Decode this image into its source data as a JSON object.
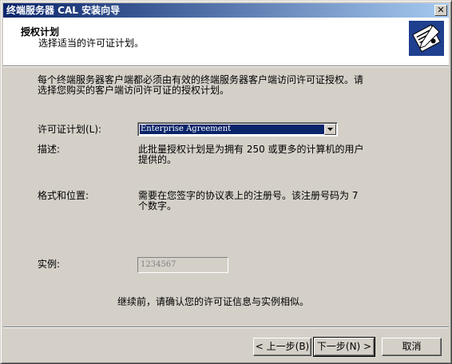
{
  "window": {
    "title": "终端服务器 CAL 安装向导",
    "close_symbol": "✕"
  },
  "header": {
    "title": "授权计划",
    "subtitle": "选择适当的许可证计划。",
    "icon": "license-document-icon"
  },
  "content": {
    "intro_line1": "每个终端服务器客户端都必须由有效的终端服务器客户端访问许可证授权。请",
    "intro_line2": "选择您购买的客户端访问许可证的授权计划。",
    "license_plan_label": "许可证计划(L):",
    "license_plan_value": "Enterprise Agreement",
    "description_label": "描述:",
    "description_line1": "此批量授权计划是为拥有 250 或更多的计算机的用户",
    "description_line2": "提供的。",
    "format_label": "格式和位置:",
    "format_line1": "需要在您签字的协议表上的注册号。该注册号码为 7",
    "format_line2": "个数字。",
    "example_label": "实例:",
    "example_value": "1234567",
    "confirm_text": "继续前，请确认您的许可证信息与实例相似。"
  },
  "buttons": {
    "back": "< 上一步(B)",
    "next": "下一步(N) >",
    "cancel": "取消"
  },
  "colors": {
    "title_bar_start": "#0a246a",
    "title_bar_end": "#a6caf0",
    "dialog_bg": "#d4d0c8",
    "selection": "#0a246a"
  }
}
